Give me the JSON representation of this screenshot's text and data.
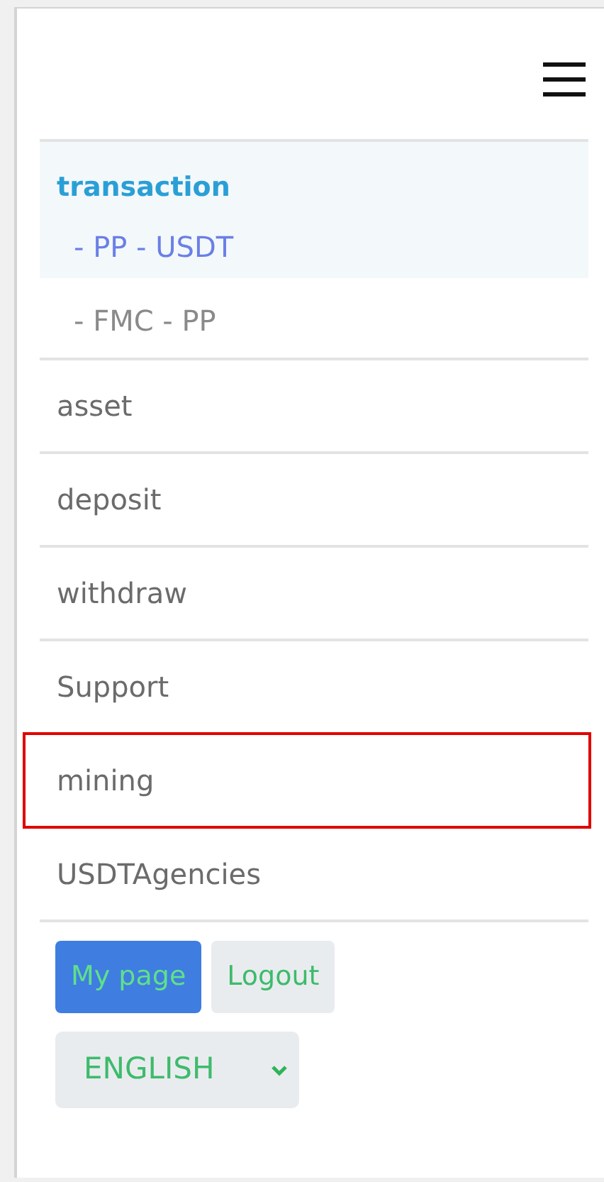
{
  "menu_icon": {
    "kind": "hamburger"
  },
  "section": {
    "title": "transaction",
    "selected": true,
    "children": [
      {
        "label": "- PP - USDT",
        "selected": true
      },
      {
        "label": "- FMC - PP",
        "selected": false
      }
    ]
  },
  "items": [
    {
      "label": "asset",
      "highlighted": false
    },
    {
      "label": "deposit",
      "highlighted": false
    },
    {
      "label": "withdraw",
      "highlighted": false
    },
    {
      "label": "Support",
      "highlighted": false
    },
    {
      "label": "mining",
      "highlighted": true
    },
    {
      "label": "USDTAgencies",
      "highlighted": false
    }
  ],
  "buttons": [
    {
      "label": "My page",
      "kind": "primary"
    },
    {
      "label": "Logout",
      "kind": "secondary"
    }
  ],
  "language_select": {
    "value": "ENGLISH"
  }
}
